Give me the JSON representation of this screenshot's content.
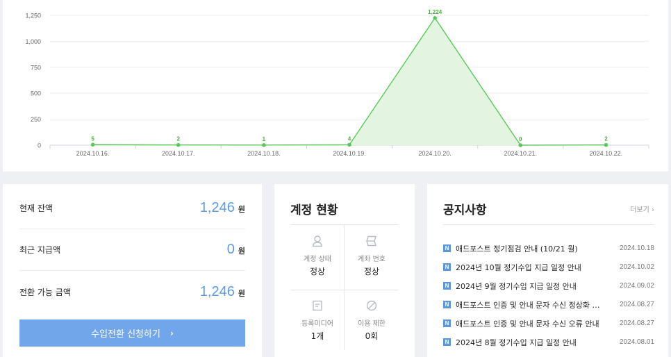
{
  "chart_data": {
    "type": "area",
    "x": [
      "2024.10.16.",
      "2024.10.17.",
      "2024.10.18.",
      "2024.10.19.",
      "2024.10.20.",
      "2024.10.21.",
      "2024.10.22."
    ],
    "y_ticks": [
      "0",
      "250",
      "500",
      "750",
      "1,000",
      "1,250"
    ],
    "ylim": [
      0,
      1250
    ],
    "series": [
      {
        "values": [
          5,
          2,
          1,
          4,
          1224,
          0,
          2
        ],
        "labels": [
          "5",
          "2",
          "1",
          "4",
          "1,224",
          "0",
          "2"
        ]
      }
    ],
    "colors": {
      "line": "#5cc85c",
      "fill": "#e3f4e1",
      "label": "#4fae3f"
    },
    "grid": true,
    "legend": "none"
  },
  "balance": {
    "rows": [
      {
        "label": "현재 잔액",
        "value": "1,246",
        "unit": "원"
      },
      {
        "label": "최근 지급액",
        "value": "0",
        "unit": "원"
      },
      {
        "label": "전환 가능 금액",
        "value": "1,246",
        "unit": "원"
      }
    ],
    "button_label": "수입전환 신청하기",
    "button_chevron": "›"
  },
  "account": {
    "title": "계정 현황",
    "cells": [
      {
        "icon": "user-icon",
        "label": "계정 상태",
        "value": "정상"
      },
      {
        "icon": "bank-icon",
        "label": "계좌 번호",
        "value": "정상"
      },
      {
        "icon": "media-icon",
        "label": "등록미디어",
        "value": "1개"
      },
      {
        "icon": "ban-icon",
        "label": "이용 제한",
        "value": "0회"
      }
    ]
  },
  "notice": {
    "title": "공지사항",
    "more_label": "더보기 ›",
    "badge": "N",
    "items": [
      {
        "title": "애드포스트 정기점검 안내 (10/21 월)",
        "date": "2024.10.18"
      },
      {
        "title": "2024년 10월 정기수입 지급 일정 안내",
        "date": "2024.10.02"
      },
      {
        "title": "2024년 9월 정기수입 지급 일정 안내",
        "date": "2024.09.02"
      },
      {
        "title": "애드포스트 인증 및 안내 문자 수신 정상화 …",
        "date": "2024.08.27"
      },
      {
        "title": "애드포스트 인증 및 안내 문자 수신 오류 안내",
        "date": "2024.08.27"
      },
      {
        "title": "2024년 8월 정기수입 지급 일정 안내",
        "date": "2024.08.01"
      }
    ]
  }
}
